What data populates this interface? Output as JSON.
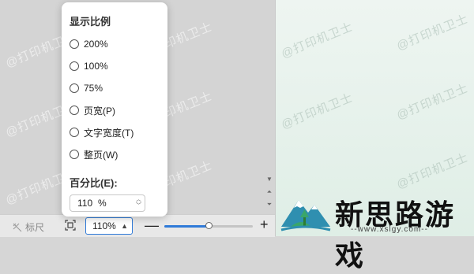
{
  "watermark": "@打印机卫士",
  "popup": {
    "title": "显示比例",
    "options": [
      {
        "label": "200%",
        "selected": false
      },
      {
        "label": "100%",
        "selected": false
      },
      {
        "label": "75%",
        "selected": false
      },
      {
        "label": "页宽(P)",
        "selected": false
      },
      {
        "label": "文字宽度(T)",
        "selected": false
      },
      {
        "label": "整页(W)",
        "selected": false
      }
    ],
    "percent_label": "百分比(E):",
    "percent_value": "110",
    "percent_unit": "%"
  },
  "statusbar": {
    "ruler_label": "标尺",
    "zoom_value": "110%",
    "zoom_level": 0.5,
    "accent_color": "#2f7ad8"
  },
  "brand": {
    "name": "新思路游戏",
    "url": "--www.xslgy.com--"
  }
}
